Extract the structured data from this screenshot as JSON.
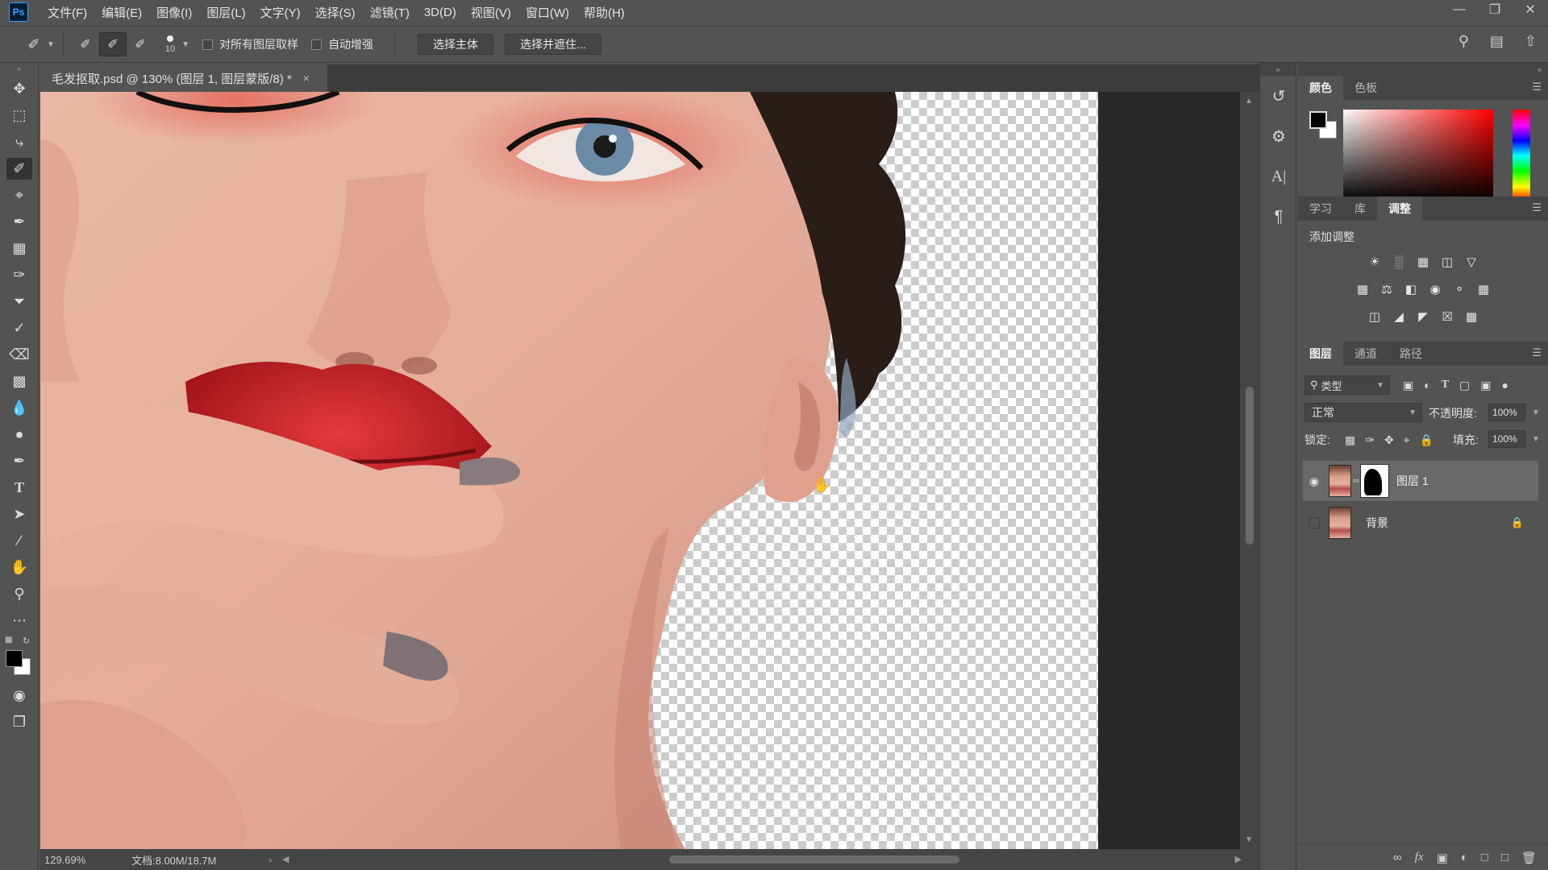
{
  "app": {
    "logo": "Ps"
  },
  "menu": [
    "文件(F)",
    "编辑(E)",
    "图像(I)",
    "图层(L)",
    "文字(Y)",
    "选择(S)",
    "滤镜(T)",
    "3D(D)",
    "视图(V)",
    "窗口(W)",
    "帮助(H)"
  ],
  "options": {
    "brush_size": "10",
    "sample_all_layers": "对所有图层取样",
    "auto_enhance": "自动增强",
    "select_subject": "选择主体",
    "select_and_mask": "选择并遮住..."
  },
  "document": {
    "tab_title": "毛发抠取.psd @ 130% (图层 1, 图层蒙版/8) *",
    "close": "×"
  },
  "status": {
    "zoom": "129.69%",
    "doc_info": "文档:8.00M/18.7M",
    "arrow": "›"
  },
  "panels": {
    "color_tabs": [
      "颜色",
      "色板"
    ],
    "adjust_tabs": [
      "学习",
      "库",
      "调整"
    ],
    "adjust_title": "添加调整",
    "layers_tabs": [
      "图层",
      "通道",
      "路径"
    ],
    "filter_kind": "类型",
    "blend_mode": "正常",
    "opacity_label": "不透明度:",
    "opacity": "100%",
    "lock_label": "锁定:",
    "fill_label": "填充:",
    "fill": "100%"
  },
  "layers": [
    {
      "name": "图层 1",
      "visible": true,
      "selected": true,
      "has_mask": true
    },
    {
      "name": "背景",
      "visible": false,
      "selected": false,
      "locked": true
    }
  ],
  "colors": {
    "foreground": "#000000",
    "background": "#ffffff",
    "accent": "#31a8ff"
  }
}
